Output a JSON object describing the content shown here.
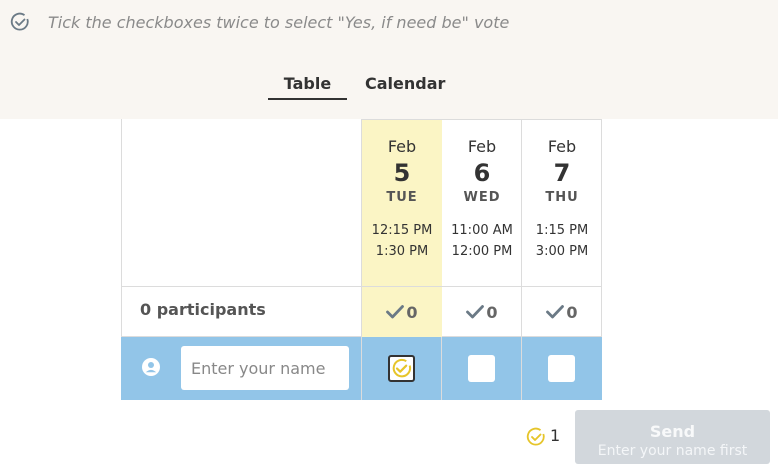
{
  "hint": {
    "text": "Tick the checkboxes twice to select \"Yes, if need be\" vote",
    "icon": "check-circle-icon"
  },
  "tabs": [
    {
      "label": "Table",
      "active": true
    },
    {
      "label": "Calendar",
      "active": false
    }
  ],
  "dates": [
    {
      "month": "Feb",
      "day": "5",
      "weekday": "TUE",
      "start": "12:15 PM",
      "end": "1:30 PM",
      "count": "0",
      "highlighted": true
    },
    {
      "month": "Feb",
      "day": "6",
      "weekday": "WED",
      "start": "11:00 AM",
      "end": "12:00 PM",
      "count": "0",
      "highlighted": false
    },
    {
      "month": "Feb",
      "day": "7",
      "weekday": "THU",
      "start": "1:15 PM",
      "end": "3:00 PM",
      "count": "0",
      "highlighted": false
    }
  ],
  "participants_label": "0 participants",
  "vote_row": {
    "name_placeholder": "Enter your name",
    "votes": [
      "if-need-be",
      "none",
      "none"
    ]
  },
  "footer": {
    "ifneed_count": "1"
  },
  "send": {
    "label": "Send",
    "sublabel": "Enter your name first"
  },
  "colors": {
    "highlight": "#fbf5c5",
    "vote_row": "#92c5e8",
    "ifneed": "#e6c52a",
    "panel": "#f9f6f2"
  }
}
